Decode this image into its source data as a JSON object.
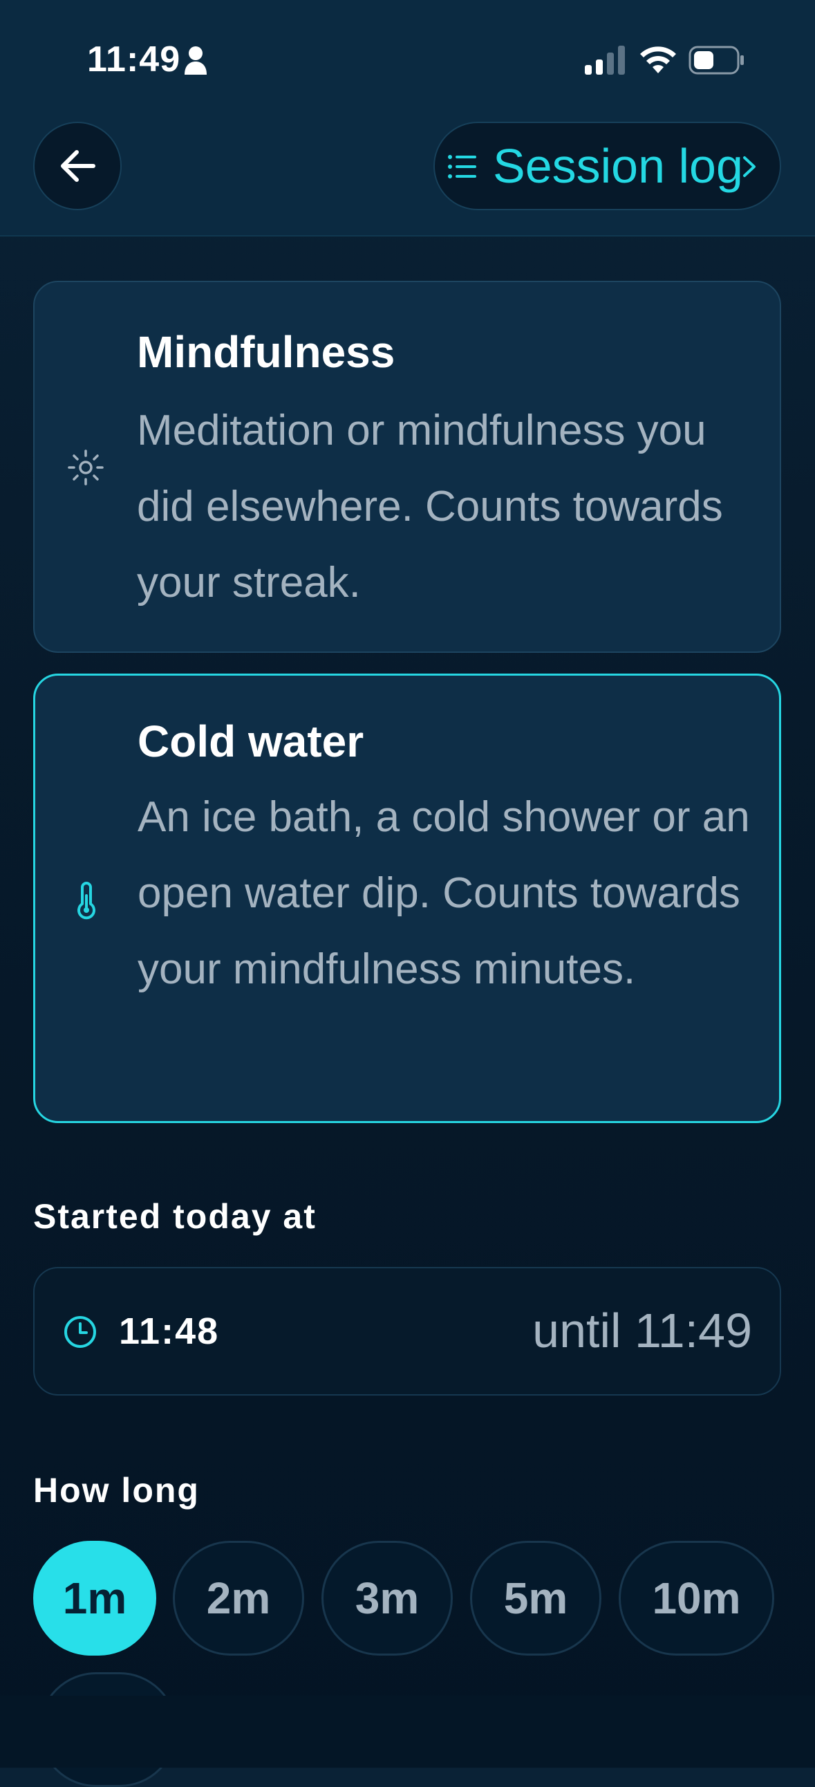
{
  "status_bar": {
    "time": "11:49"
  },
  "header": {
    "session_log_label": "Session log"
  },
  "cards": [
    {
      "title": "Mindfulness",
      "description": "Meditation or mindfulness you did elsewhere. Counts towards your streak.",
      "icon": "sun-icon",
      "selected": false
    },
    {
      "title": "Cold water",
      "description": "An ice bath, a cold shower or an open water dip. Counts towards your mindfulness minutes.",
      "icon": "thermometer-icon",
      "selected": true
    }
  ],
  "started": {
    "label": "Started today at",
    "start_time": "11:48",
    "end_text": "until 11:49"
  },
  "duration": {
    "label": "How long",
    "options": [
      "1m",
      "2m",
      "3m",
      "5m",
      "10m"
    ],
    "selected": "1m"
  },
  "colors": {
    "accent": "#26d6e2",
    "background": "#071a2b",
    "card": "#0e2e47",
    "muted_text": "#a4b3c0"
  }
}
